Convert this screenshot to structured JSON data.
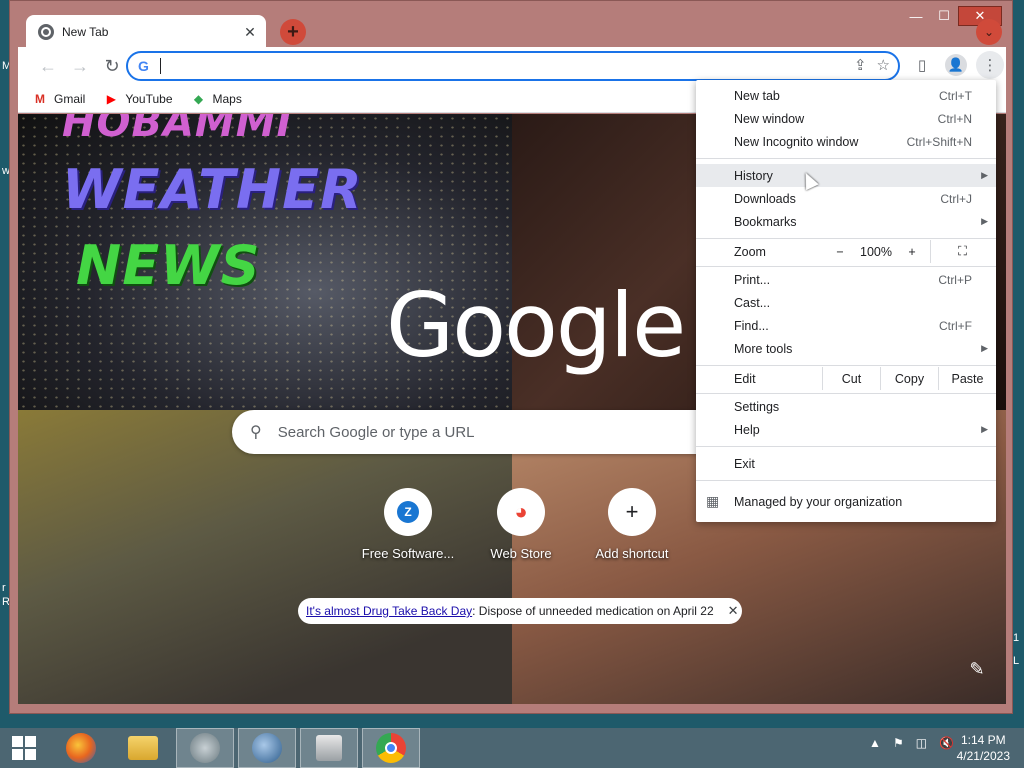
{
  "window": {
    "controls": {
      "minimize": "—",
      "maximize": "☐",
      "close": "✕"
    }
  },
  "tab": {
    "title": "New Tab",
    "close": "✕",
    "new_tab": "+",
    "tab_search": "⌄"
  },
  "toolbar": {
    "back": "←",
    "forward": "→",
    "reload": "↻",
    "omnibox_icon": "G",
    "omnibox_value": "",
    "share": "⇪",
    "bookmark_star": "☆",
    "side_panel": "▯",
    "profile": "👤",
    "menu": "⋮"
  },
  "bookmarks": [
    {
      "label": "Gmail",
      "icon": "M",
      "color": "#d93025"
    },
    {
      "label": "YouTube",
      "icon": "▶",
      "color": "#ff0000"
    },
    {
      "label": "Maps",
      "icon": "◆",
      "color": "#34a853"
    }
  ],
  "ntp": {
    "logo": "Google",
    "search_placeholder": "Search Google or type a URL",
    "shortcuts": [
      {
        "label": "Free Software...",
        "icon": "Z"
      },
      {
        "label": "Web Store",
        "icon": "◕"
      },
      {
        "label": "Add shortcut",
        "icon": "+"
      }
    ],
    "promo_link": "It's almost Drug Take Back Day",
    "promo_text": ": Dispose of unneeded medication on April 22",
    "promo_close": "✕",
    "customize": "✎",
    "background_text": {
      "line1": "HOBAMMI",
      "line2": "WEATHER",
      "line3": "NEWS"
    }
  },
  "menu": {
    "new_tab": {
      "label": "New tab",
      "shortcut": "Ctrl+T"
    },
    "new_window": {
      "label": "New window",
      "shortcut": "Ctrl+N"
    },
    "incognito": {
      "label": "New Incognito window",
      "shortcut": "Ctrl+Shift+N"
    },
    "history": {
      "label": "History"
    },
    "downloads": {
      "label": "Downloads",
      "shortcut": "Ctrl+J"
    },
    "bookmarks": {
      "label": "Bookmarks"
    },
    "zoom": {
      "label": "Zoom",
      "minus": "−",
      "value": "100%",
      "plus": "+",
      "fullscreen": "⛶"
    },
    "print": {
      "label": "Print...",
      "shortcut": "Ctrl+P"
    },
    "cast": {
      "label": "Cast..."
    },
    "find": {
      "label": "Find...",
      "shortcut": "Ctrl+F"
    },
    "more_tools": {
      "label": "More tools"
    },
    "edit": {
      "label": "Edit",
      "cut": "Cut",
      "copy": "Copy",
      "paste": "Paste"
    },
    "settings": {
      "label": "Settings"
    },
    "help": {
      "label": "Help"
    },
    "exit": {
      "label": "Exit"
    },
    "managed": {
      "label": "Managed by your organization"
    },
    "submenu_arrow": "▶"
  },
  "taskbar": {
    "clock_time": "1:14 PM",
    "clock_date": "4/21/2023",
    "tray_up": "▲",
    "apps": [
      "firefox",
      "file-explorer",
      "app-3",
      "network-globe",
      "app-5",
      "chrome"
    ]
  },
  "desktop_fragments": [
    "M",
    "w",
    "r",
    "R",
    "1",
    "L"
  ]
}
